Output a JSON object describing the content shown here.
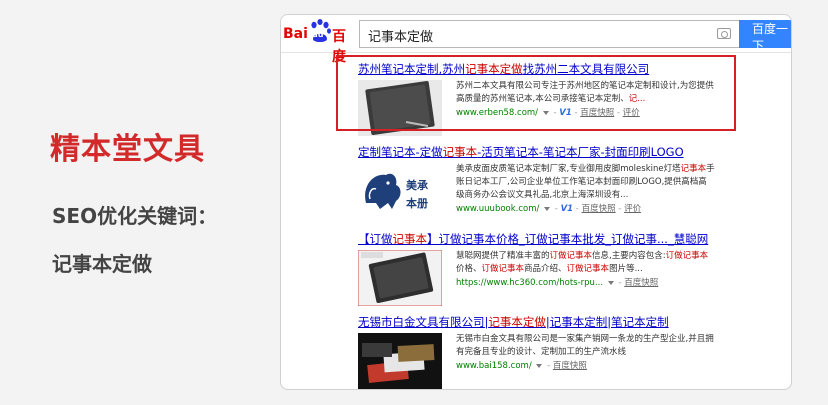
{
  "left": {
    "brand": "精本堂文具",
    "seo_label": "SEO优化关键词：",
    "keyword": "记事本定做"
  },
  "search": {
    "logo_left": "Bai",
    "logo_du": "du",
    "logo_right": "百度",
    "query": "记事本定做",
    "button": "百度一下"
  },
  "results": [
    {
      "title_a": "苏州笔记本定制,苏州",
      "title_hl": "记事本定做",
      "title_b": "找苏州二本文具有限公司",
      "line1": "苏州二本文具有限公司专注于苏州地区的笔记本定制和设计,为您提供",
      "line2a": "高质量的苏州笔记本,本公司承接笔记本定制、",
      "line2hl": "记...",
      "url": "www.erben58.com/",
      "v1": "V1",
      "snapshot": "百度快照",
      "review": "评价"
    },
    {
      "title_a": "定制笔记本-定做",
      "title_hl": "记事本",
      "title_b": "-活页笔记本-笔记本厂家-封面印刷LOGO",
      "line1a": "美承皮面皮质笔记本定制厂家,专业御用皮脚moleskine灯塔",
      "line1hl": "记事本",
      "line1b": "手",
      "line2": "账日记本工厂,公司企业单位工作笔记本封面印刷LOGO,提供高档高",
      "line3": "级商务办公会议文具礼品,北京上海深圳设有...",
      "url": "www.uuubook.com/",
      "v1": "V1",
      "snapshot": "百度快照",
      "review": "评价",
      "thumb_text_1": "美承",
      "thumb_text_2": "本册"
    },
    {
      "title_a": "【订做",
      "title_hl": "记事本",
      "title_b": "】订做记事本价格_订做记事本批发_订做记事..._慧聪网",
      "line1a": "慧聪网提供了精准丰富的",
      "line1hl": "订做记事本",
      "line1b": "信息,主要内容包含:",
      "line1hl2": "订做记事本",
      "line2a": "价格、",
      "line2hl": "订做记事本",
      "line2b": "商品介绍、",
      "line2hl2": "订做记事本",
      "line2c": "图片等...",
      "url": "https://www.hc360.com/hots-rpu...",
      "snapshot": "百度快照"
    },
    {
      "title_a": "无锡市白金文具有限公司|",
      "title_hl": "记事本定做",
      "title_b": "|记事本定制|笔记本定制",
      "line1": "无锡市白金文具有限公司是一家集产销网一条龙的生产型企业,并且拥",
      "line2": "有完备且专业的设计、定制加工的生产流水线",
      "url": "www.bai158.com/",
      "snapshot": "百度快照"
    }
  ],
  "colors": {
    "brand_red": "#d22a2a",
    "link_blue": "#0000cc",
    "highlight_red": "#c00000",
    "url_green": "#008000",
    "baidu_blue": "#3385ff",
    "box_red": "#d52026"
  }
}
